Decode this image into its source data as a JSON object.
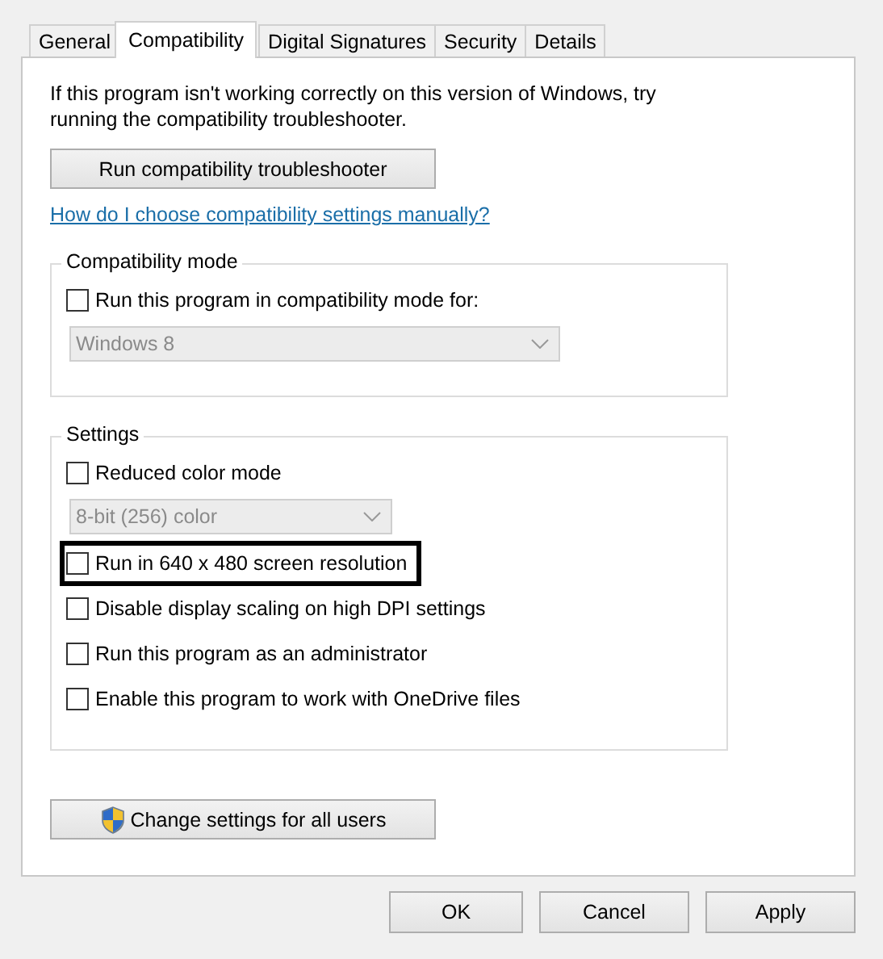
{
  "tabs": [
    {
      "label": "General",
      "selected": false
    },
    {
      "label": "Compatibility",
      "selected": true
    },
    {
      "label": "Digital Signatures",
      "selected": false
    },
    {
      "label": "Security",
      "selected": false
    },
    {
      "label": "Details",
      "selected": false
    }
  ],
  "intro": "If this program isn't working correctly on this version of Windows, try running the compatibility troubleshooter.",
  "troubleshoot_button": "Run compatibility troubleshooter",
  "help_link": "How do I choose compatibility settings manually?",
  "groups": [
    {
      "title": "Compatibility mode",
      "items": [
        {
          "kind": "checkbox",
          "label": "Run this program in compatibility mode for:",
          "checked": false,
          "highlighted": false
        },
        {
          "kind": "dropdown",
          "value": "Windows 8",
          "disabled": true
        }
      ]
    },
    {
      "title": "Settings",
      "items": [
        {
          "kind": "checkbox",
          "label": "Reduced color mode",
          "checked": false,
          "highlighted": false
        },
        {
          "kind": "dropdown",
          "value": "8-bit (256) color",
          "disabled": true
        },
        {
          "kind": "checkbox",
          "label": "Run in 640 x 480 screen resolution",
          "checked": false,
          "highlighted": true
        },
        {
          "kind": "checkbox",
          "label": "Disable display scaling on high DPI settings",
          "checked": false,
          "highlighted": false
        },
        {
          "kind": "checkbox",
          "label": "Run this program as an administrator",
          "checked": false,
          "highlighted": false
        },
        {
          "kind": "checkbox",
          "label": "Enable this program to work with OneDrive files",
          "checked": false,
          "highlighted": false
        }
      ]
    }
  ],
  "all_users_button": "Change settings for all users",
  "buttons": [
    {
      "label": "OK"
    },
    {
      "label": "Cancel"
    },
    {
      "label": "Apply"
    }
  ]
}
